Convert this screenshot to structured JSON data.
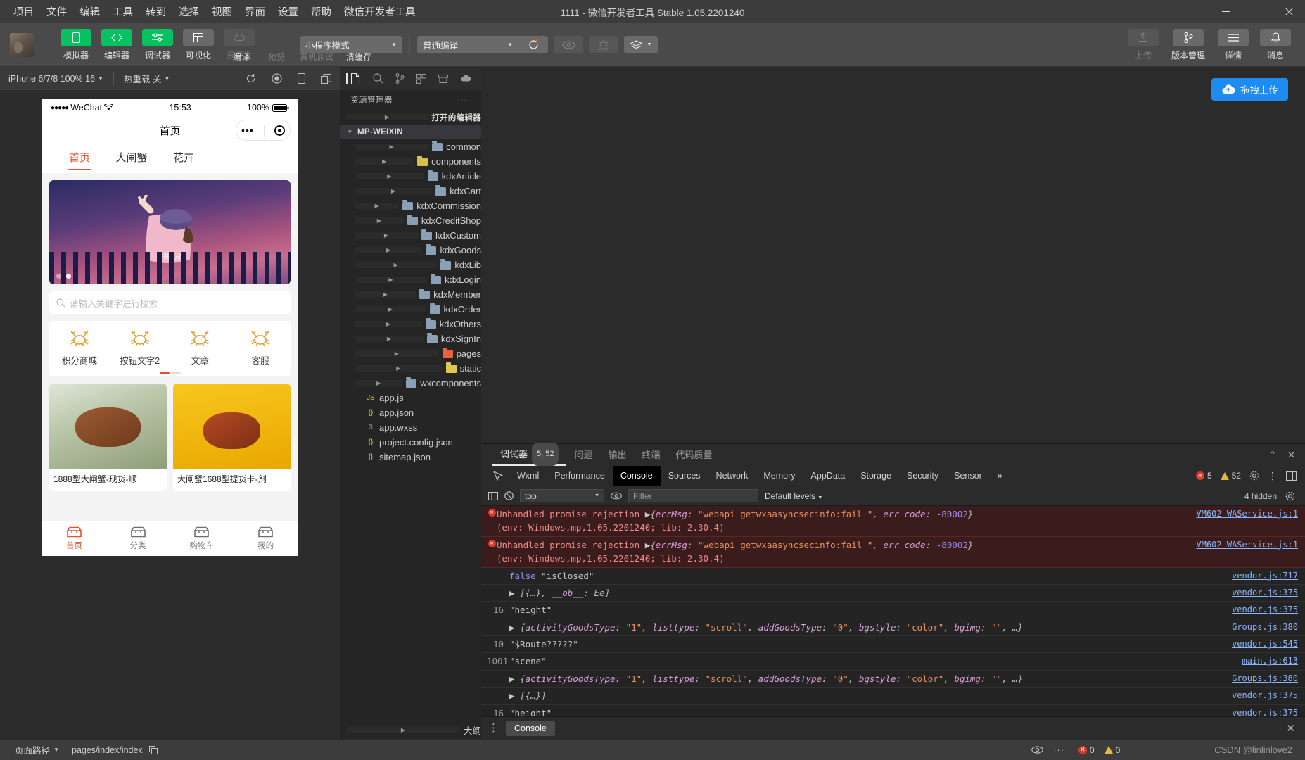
{
  "window": {
    "title": "1111 - 微信开发者工具 Stable 1.05.2201240",
    "menu": [
      "项目",
      "文件",
      "编辑",
      "工具",
      "转到",
      "选择",
      "视图",
      "界面",
      "设置",
      "帮助",
      "微信开发者工具"
    ],
    "controls": {
      "minimize": "—",
      "maximize": "❐",
      "close": "✕"
    }
  },
  "toolbar": {
    "left_buttons": [
      {
        "label": "模拟器",
        "icon": "phone-icon",
        "state": "active"
      },
      {
        "label": "编辑器",
        "icon": "code-icon",
        "state": "active"
      },
      {
        "label": "调试器",
        "icon": "sliders-icon",
        "state": "active"
      },
      {
        "label": "可视化",
        "icon": "layout-icon",
        "state": "inactive"
      },
      {
        "label": "云开发",
        "icon": "cloud-icon",
        "state": "disabled"
      }
    ],
    "mode_select": {
      "value": "小程序模式"
    },
    "compile_select": {
      "value": "普通编译"
    },
    "actions": [
      {
        "label": "编译",
        "icon": "refresh-icon",
        "state": "enabled"
      },
      {
        "label": "预览",
        "icon": "eye-icon",
        "state": "disabled"
      },
      {
        "label": "真机调试",
        "icon": "bug-icon",
        "state": "disabled"
      },
      {
        "label": "清缓存",
        "icon": "layers-icon",
        "state": "enabled"
      }
    ],
    "right_buttons": [
      {
        "label": "上传",
        "icon": "upload-icon",
        "state": "disabled"
      },
      {
        "label": "版本管理",
        "icon": "branch-icon",
        "state": "enabled"
      },
      {
        "label": "详情",
        "icon": "menu-icon",
        "state": "enabled"
      },
      {
        "label": "消息",
        "icon": "bell-icon",
        "state": "enabled"
      }
    ]
  },
  "simulator": {
    "device_select": "iPhone 6/7/8 100% 16",
    "hotreload_select": "热重载 关",
    "toolbar_icons": [
      "refresh-icon",
      "record-icon",
      "rotate-icon",
      "window-icon"
    ],
    "phone": {
      "status": {
        "carrier": "WeChat",
        "signal_dots": "●●●●●",
        "time": "15:53",
        "battery": "100%"
      },
      "nav_title": "首页",
      "tabs": [
        {
          "label": "首页",
          "active": true
        },
        {
          "label": "大闸蟹",
          "active": false
        },
        {
          "label": "花卉",
          "active": false
        }
      ],
      "banner": {
        "caption": "开开心心",
        "dot_count": 2,
        "active_dot": 1
      },
      "search_placeholder": "请输入关键字进行搜索",
      "grid": [
        {
          "label": "积分商城",
          "icon": "crab-icon"
        },
        {
          "label": "按钮文字2",
          "icon": "crab-icon"
        },
        {
          "label": "文章",
          "icon": "crab-icon"
        },
        {
          "label": "客服",
          "icon": "crab-icon"
        }
      ],
      "cards": [
        {
          "title": "1888型大闸蟹-现货-顺"
        },
        {
          "title": "大闸蟹1688型提货卡-剂"
        }
      ],
      "tabbar": [
        {
          "label": "首页",
          "icon": "home-icon",
          "active": true
        },
        {
          "label": "分类",
          "icon": "category-icon",
          "active": false
        },
        {
          "label": "购物车",
          "icon": "cart-icon",
          "active": false
        },
        {
          "label": "我的",
          "icon": "user-icon",
          "active": false
        }
      ]
    }
  },
  "explorer": {
    "bar_icons": [
      "files-icon",
      "search-icon",
      "branch-icon",
      "extensions-icon",
      "archive-icon",
      "cloud-icon"
    ],
    "title": "资源管理器",
    "more": "···",
    "sections": [
      {
        "label": "打开的编辑器",
        "expanded": false
      },
      {
        "label": "MP-WEIXIN",
        "expanded": true
      }
    ],
    "tree": [
      {
        "name": "common",
        "type": "folder",
        "color": "blue"
      },
      {
        "name": "components",
        "type": "folder",
        "color": "yellow"
      },
      {
        "name": "kdxArticle",
        "type": "folder",
        "color": "blue"
      },
      {
        "name": "kdxCart",
        "type": "folder",
        "color": "blue"
      },
      {
        "name": "kdxCommission",
        "type": "folder",
        "color": "blue"
      },
      {
        "name": "kdxCreditShop",
        "type": "folder",
        "color": "blue"
      },
      {
        "name": "kdxCustom",
        "type": "folder",
        "color": "blue"
      },
      {
        "name": "kdxGoods",
        "type": "folder",
        "color": "blue"
      },
      {
        "name": "kdxLib",
        "type": "folder",
        "color": "blue"
      },
      {
        "name": "kdxLogin",
        "type": "folder",
        "color": "blue"
      },
      {
        "name": "kdxMember",
        "type": "folder",
        "color": "blue"
      },
      {
        "name": "kdxOrder",
        "type": "folder",
        "color": "blue"
      },
      {
        "name": "kdxOthers",
        "type": "folder",
        "color": "blue"
      },
      {
        "name": "kdxSignIn",
        "type": "folder",
        "color": "blue"
      },
      {
        "name": "pages",
        "type": "folder",
        "color": "orange"
      },
      {
        "name": "static",
        "type": "folder",
        "color": "yellow2"
      },
      {
        "name": "wxcomponents",
        "type": "folder",
        "color": "blue"
      },
      {
        "name": "app.js",
        "type": "file",
        "kind": "js"
      },
      {
        "name": "app.json",
        "type": "file",
        "kind": "json"
      },
      {
        "name": "app.wxss",
        "type": "file",
        "kind": "wxss"
      },
      {
        "name": "project.config.json",
        "type": "file",
        "kind": "json"
      },
      {
        "name": "sitemap.json",
        "type": "file",
        "kind": "json"
      }
    ],
    "footer": "大纲"
  },
  "upload_bar": {
    "label": "拖拽上传",
    "icon": "cloud-upload-icon",
    "color": "#1d8cf0"
  },
  "devtools": {
    "top_tabs": [
      {
        "label": "调试器",
        "badge": "5, 52",
        "active": true
      },
      {
        "label": "问题",
        "badge": "",
        "active": false
      },
      {
        "label": "输出",
        "badge": "",
        "active": false
      },
      {
        "label": "终端",
        "badge": "",
        "active": false
      },
      {
        "label": "代码质量",
        "badge": "",
        "active": false
      }
    ],
    "top_controls": [
      "collapse-icon",
      "close-icon"
    ],
    "panel_tabs": [
      {
        "label": "Wxml",
        "active": false
      },
      {
        "label": "Performance",
        "active": false
      },
      {
        "label": "Console",
        "active": true
      },
      {
        "label": "Sources",
        "active": false
      },
      {
        "label": "Network",
        "active": false
      },
      {
        "label": "Memory",
        "active": false
      },
      {
        "label": "AppData",
        "active": false
      },
      {
        "label": "Storage",
        "active": false
      },
      {
        "label": "Security",
        "active": false
      },
      {
        "label": "Sensor",
        "active": false
      }
    ],
    "overflow": "»",
    "error_count": "5",
    "warning_count": "52",
    "settings_icon": "gear-icon",
    "kebab_icon": "kebab-icon",
    "dock_icon": "dock-icon",
    "filter_bar": {
      "sidebar_icon": "console-sidebar-icon",
      "clear_icon": "clear-icon",
      "context": "top",
      "eye_icon": "eye-icon",
      "filter_placeholder": "Filter",
      "levels": "Default levels",
      "hidden": "4 hidden",
      "settings_icon": "gear-icon"
    },
    "logs": [
      {
        "type": "error",
        "count": "",
        "segments": [
          {
            "t": "Unhandled promise rejection ",
            "c": "err"
          },
          {
            "t": "▶",
            "c": "tri"
          },
          {
            "t": "{",
            "c": "obj"
          },
          {
            "t": "errMsg",
            "c": "key"
          },
          {
            "t": ": ",
            "c": "obj"
          },
          {
            "t": "\"webapi_getwxaasyncsecinfo:fail \"",
            "c": "str"
          },
          {
            "t": ", ",
            "c": "obj"
          },
          {
            "t": "err_code",
            "c": "key"
          },
          {
            "t": ": ",
            "c": "obj"
          },
          {
            "t": "-80002",
            "c": "num"
          },
          {
            "t": "}",
            "c": "obj"
          }
        ],
        "sub": "(env: Windows,mp,1.05.2201240; lib: 2.30.4)",
        "source": "VM602 WAService.js:1"
      },
      {
        "type": "error",
        "count": "",
        "segments": [
          {
            "t": "Unhandled promise rejection ",
            "c": "err"
          },
          {
            "t": "▶",
            "c": "tri"
          },
          {
            "t": "{",
            "c": "obj"
          },
          {
            "t": "errMsg",
            "c": "key"
          },
          {
            "t": ": ",
            "c": "obj"
          },
          {
            "t": "\"webapi_getwxaasyncsecinfo:fail \"",
            "c": "str"
          },
          {
            "t": ", ",
            "c": "obj"
          },
          {
            "t": "err_code",
            "c": "key"
          },
          {
            "t": ": ",
            "c": "obj"
          },
          {
            "t": "-80002",
            "c": "num"
          },
          {
            "t": "}",
            "c": "obj"
          }
        ],
        "sub": "(env: Windows,mp,1.05.2201240; lib: 2.30.4)",
        "source": "VM602 WAService.js:1"
      },
      {
        "type": "log",
        "num": "",
        "segments": [
          {
            "t": "false ",
            "c": "kw"
          },
          {
            "t": "\"isClosed\"",
            "c": "dim"
          }
        ],
        "source": "vendor.js:717"
      },
      {
        "type": "log",
        "num": "",
        "expandable": true,
        "segments": [
          {
            "t": "[{…}, ",
            "c": "obj"
          },
          {
            "t": "__ob__",
            "c": "key"
          },
          {
            "t": ": ",
            "c": "obj"
          },
          {
            "t": "Ee]",
            "c": "obj"
          }
        ],
        "source": "vendor.js:375"
      },
      {
        "type": "log",
        "num": "16",
        "segments": [
          {
            "t": "\"height\"",
            "c": "dim"
          }
        ],
        "source": "vendor.js:375"
      },
      {
        "type": "log",
        "num": "",
        "expandable": true,
        "segments": [
          {
            "t": "{",
            "c": "obj"
          },
          {
            "t": "activityGoodsType",
            "c": "key"
          },
          {
            "t": ": ",
            "c": "obj"
          },
          {
            "t": "\"1\"",
            "c": "str"
          },
          {
            "t": ", ",
            "c": "obj"
          },
          {
            "t": "listtype",
            "c": "key"
          },
          {
            "t": ": ",
            "c": "obj"
          },
          {
            "t": "\"scroll\"",
            "c": "str"
          },
          {
            "t": ", ",
            "c": "obj"
          },
          {
            "t": "addGoodsType",
            "c": "key"
          },
          {
            "t": ": ",
            "c": "obj"
          },
          {
            "t": "\"0\"",
            "c": "str"
          },
          {
            "t": ", ",
            "c": "obj"
          },
          {
            "t": "bgstyle",
            "c": "key"
          },
          {
            "t": ": ",
            "c": "obj"
          },
          {
            "t": "\"color\"",
            "c": "str"
          },
          {
            "t": ", ",
            "c": "obj"
          },
          {
            "t": "bgimg",
            "c": "key"
          },
          {
            "t": ": ",
            "c": "obj"
          },
          {
            "t": "\"\"",
            "c": "str"
          },
          {
            "t": ", …}",
            "c": "obj"
          }
        ],
        "source": "Groups.js:380"
      },
      {
        "type": "log",
        "num": "10",
        "segments": [
          {
            "t": "\"$Route?????\"",
            "c": "dim"
          }
        ],
        "source": "vendor.js:545"
      },
      {
        "type": "log",
        "num": "1001",
        "segments": [
          {
            "t": "\"scene\"",
            "c": "dim"
          }
        ],
        "source": "main.js:613"
      },
      {
        "type": "log",
        "num": "",
        "expandable": true,
        "segments": [
          {
            "t": "{",
            "c": "obj"
          },
          {
            "t": "activityGoodsType",
            "c": "key"
          },
          {
            "t": ": ",
            "c": "obj"
          },
          {
            "t": "\"1\"",
            "c": "str"
          },
          {
            "t": ", ",
            "c": "obj"
          },
          {
            "t": "listtype",
            "c": "key"
          },
          {
            "t": ": ",
            "c": "obj"
          },
          {
            "t": "\"scroll\"",
            "c": "str"
          },
          {
            "t": ", ",
            "c": "obj"
          },
          {
            "t": "addGoodsType",
            "c": "key"
          },
          {
            "t": ": ",
            "c": "obj"
          },
          {
            "t": "\"0\"",
            "c": "str"
          },
          {
            "t": ", ",
            "c": "obj"
          },
          {
            "t": "bgstyle",
            "c": "key"
          },
          {
            "t": ": ",
            "c": "obj"
          },
          {
            "t": "\"color\"",
            "c": "str"
          },
          {
            "t": ", ",
            "c": "obj"
          },
          {
            "t": "bgimg",
            "c": "key"
          },
          {
            "t": ": ",
            "c": "obj"
          },
          {
            "t": "\"\"",
            "c": "str"
          },
          {
            "t": ", …}",
            "c": "obj"
          }
        ],
        "source": "Groups.js:380"
      },
      {
        "type": "log",
        "num": "",
        "expandable": true,
        "segments": [
          {
            "t": "[{…}]",
            "c": "obj"
          }
        ],
        "source": "vendor.js:375"
      },
      {
        "type": "log",
        "num": "16",
        "segments": [
          {
            "t": "\"height\"",
            "c": "dim"
          }
        ],
        "source": "vendor.js:375"
      },
      {
        "type": "prompt",
        "num": "",
        "segments": [],
        "source": ""
      }
    ],
    "footer": {
      "drawer_tab": "Console",
      "close": "✕"
    }
  },
  "statusbar": {
    "page_path_label": "页面路径",
    "page_path": "pages/index/index",
    "copy_icon": "copy-icon",
    "eye_icon": "eye-icon",
    "more_icon": "more-icon",
    "errors": "0",
    "warnings": "0",
    "watermark": "CSDN @linlinlove2"
  }
}
